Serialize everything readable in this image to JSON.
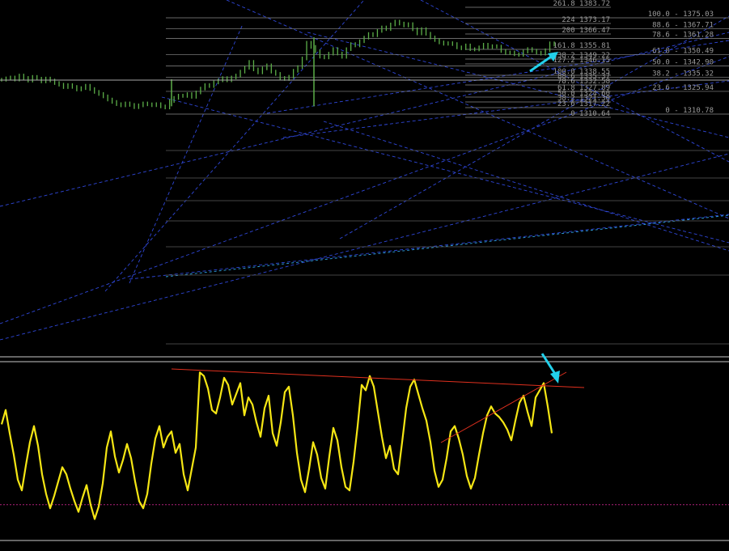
{
  "chart_data": [
    {
      "type": "line",
      "panel": "price",
      "style": "bar",
      "colors": {
        "background": "#000000",
        "price": "#5cae48",
        "fib_lines": "#8c8c8c",
        "fib_text": "#9a9a9a",
        "trendlines": "#2f47d8",
        "arrow": "#22d0ea",
        "current_price_line": "#a8a8a8"
      },
      "price_series": [
        1333.7,
        1334.6,
        1335.2,
        1333.8,
        1336.5,
        1334.9,
        1333.1,
        1335.6,
        1334.4,
        1332.6,
        1334.5,
        1333.2,
        1331.5,
        1330.4,
        1328.8,
        1330.1,
        1328.9,
        1327.2,
        1328.1,
        1329.7,
        1327.5,
        1325.6,
        1324.2,
        1322.6,
        1320.5,
        1318.9,
        1317.4,
        1316.6,
        1317.9,
        1316.9,
        1315.4,
        1316.6,
        1317.9,
        1317.3,
        1316.7,
        1317.4,
        1315.9,
        1315.2,
        1319.5,
        1321.6,
        1323.1,
        1322.9,
        1324.1,
        1322.3,
        1325.2,
        1327.8,
        1330.1,
        1329.5,
        1331.9,
        1333.3,
        1334.8,
        1333.3,
        1335.2,
        1336.5,
        1339.1,
        1341.7,
        1345.6,
        1340.6,
        1338.6,
        1341.3,
        1343.3,
        1339.1,
        1337.6,
        1334.9,
        1334.2,
        1335.7,
        1339.7,
        1342.2,
        1347.9,
        1358.4,
        1355.6,
        1352.7,
        1349.1,
        1348.6,
        1351.1,
        1354.2,
        1351.2,
        1349.0,
        1354.1,
        1357.5,
        1356.6,
        1359.4,
        1361.8,
        1364.2,
        1363.4,
        1366.3,
        1368.6,
        1367.5,
        1370.6,
        1372.5,
        1371.2,
        1369.9,
        1370.8,
        1367.4,
        1364.6,
        1367.5,
        1364.4,
        1361.9,
        1360.2,
        1358.6,
        1357.7,
        1358.1,
        1357.5,
        1355.3,
        1354.7,
        1356.6,
        1354.1,
        1353.9,
        1355.3,
        1357.1,
        1355.5,
        1356.1,
        1355.8,
        1352.9,
        1351.5,
        1351.9,
        1350.7,
        1350.3,
        1352.5,
        1354.2,
        1353.1,
        1351.8,
        1351.1,
        1353.4,
        1358.0,
        1357.2
      ],
      "fibonacci_right": {
        "title": "",
        "levels": [
          {
            "ratio": "100.0",
            "price": 1375.03
          },
          {
            "ratio": "88.6",
            "price": 1367.71
          },
          {
            "ratio": "78.6",
            "price": 1361.28
          },
          {
            "ratio": "61.8",
            "price": 1350.49
          },
          {
            "ratio": "50.0",
            "price": 1342.9
          },
          {
            "ratio": "38.2",
            "price": 1335.32
          },
          {
            "ratio": "23.6",
            "price": 1325.94
          },
          {
            "ratio": "0",
            "price": 1310.78
          }
        ]
      },
      "fibonacci_left": {
        "levels": [
          {
            "ratio": "261.8",
            "price": 1383.72
          },
          {
            "ratio": "224",
            "price": 1373.17
          },
          {
            "ratio": "200",
            "price": 1366.47
          },
          {
            "ratio": "161.8",
            "price": 1355.81
          },
          {
            "ratio": "138.2",
            "price": 1349.22
          },
          {
            "ratio": "127.2",
            "price": 1346.15
          },
          {
            "ratio": "100.0",
            "price": 1338.55
          },
          {
            "ratio": "88.6",
            "price": 1335.37
          },
          {
            "ratio": "78.6",
            "price": 1332.58
          },
          {
            "ratio": "61.8",
            "price": 1327.89
          },
          {
            "ratio": "50.0",
            "price": 1324.6
          },
          {
            "ratio": "38.2",
            "price": 1321.3
          },
          {
            "ratio": "23.6",
            "price": 1317.22
          },
          {
            "ratio": "0",
            "price": 1310.64
          }
        ]
      },
      "annotations": [
        "arrow pointing up-right toward 161.8 level"
      ]
    },
    {
      "type": "line",
      "panel": "oscillator",
      "style": "line",
      "colors": {
        "line": "#f5e614",
        "trendlines": "#e0301e",
        "level": "#b0207a",
        "arrow": "#22d0ea",
        "frame": "#c8c8c8"
      },
      "ylim": [
        0,
        100
      ],
      "level": 20,
      "series": [
        65,
        73,
        60,
        48,
        34,
        28,
        42,
        55,
        64,
        53,
        37,
        26,
        18,
        25,
        33,
        41,
        37,
        29,
        22,
        16,
        24,
        31,
        20,
        12,
        19,
        32,
        52,
        61,
        47,
        38,
        45,
        54,
        46,
        33,
        22,
        18,
        26,
        43,
        57,
        64,
        52,
        58,
        61,
        49,
        54,
        37,
        28,
        40,
        52,
        94,
        92,
        85,
        73,
        71,
        80,
        91,
        87,
        76,
        82,
        88,
        70,
        80,
        76,
        66,
        58,
        74,
        81,
        60,
        53,
        66,
        83,
        86,
        70,
        49,
        34,
        27,
        40,
        55,
        48,
        35,
        29,
        47,
        63,
        56,
        41,
        30,
        28,
        44,
        64,
        87,
        84,
        92,
        86,
        72,
        58,
        46,
        53,
        40,
        37,
        55,
        74,
        86,
        90,
        82,
        74,
        67,
        55,
        39,
        30,
        34,
        46,
        61,
        64,
        57,
        48,
        36,
        29,
        35,
        48,
        60,
        70,
        75,
        71,
        69,
        66,
        62,
        56,
        67,
        77,
        81,
        72,
        64,
        80,
        84,
        88,
        75,
        60
      ]
    }
  ]
}
